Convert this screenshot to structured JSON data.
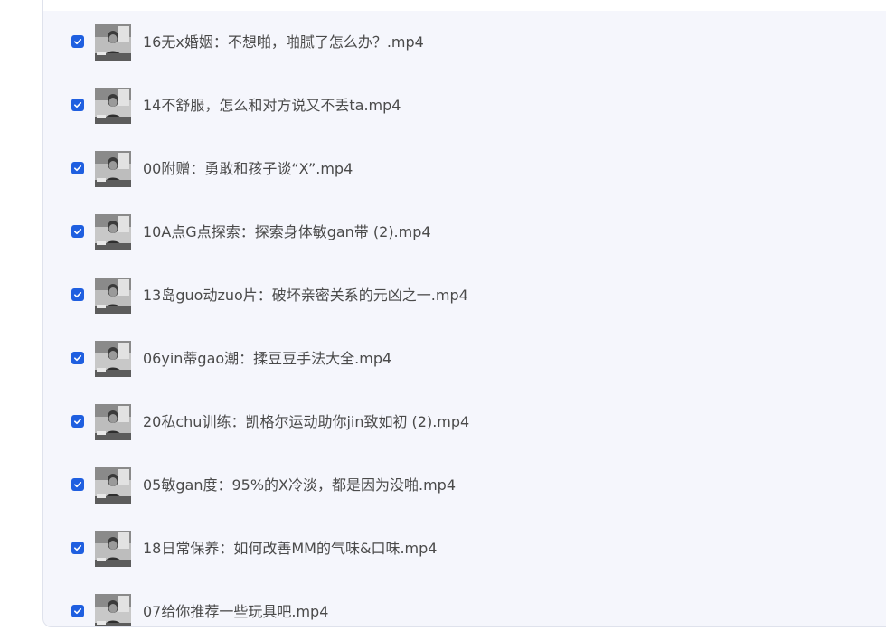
{
  "colors": {
    "panel_bg": "#f5f6fc",
    "checkbox_accent": "#1f5fe0",
    "text": "#4a4a4a"
  },
  "files": [
    {
      "name": "16无x婚姻：不想啪，啪腻了怎么办？.mp4",
      "checked": true,
      "thumbnail": "video-thumbnail"
    },
    {
      "name": "14不舒服，怎么和对方说又不丢ta.mp4",
      "checked": true,
      "thumbnail": "video-thumbnail"
    },
    {
      "name": "00附赠：勇敢和孩子谈“X”.mp4",
      "checked": true,
      "thumbnail": "video-thumbnail"
    },
    {
      "name": "10A点G点探索：探索身体敏gan带 (2).mp4",
      "checked": true,
      "thumbnail": "video-thumbnail"
    },
    {
      "name": "13岛guo动zuo片：破坏亲密关系的元凶之一.mp4",
      "checked": true,
      "thumbnail": "video-thumbnail"
    },
    {
      "name": "06yin蒂gao潮：揉豆豆手法大全.mp4",
      "checked": true,
      "thumbnail": "video-thumbnail"
    },
    {
      "name": "20私chu训练：凯格尔运动助你jin致如初 (2).mp4",
      "checked": true,
      "thumbnail": "video-thumbnail"
    },
    {
      "name": "05敏gan度：95%的X冷淡，都是因为没啪.mp4",
      "checked": true,
      "thumbnail": "video-thumbnail"
    },
    {
      "name": "18日常保养：如何改善MM的气味&口味.mp4",
      "checked": true,
      "thumbnail": "video-thumbnail"
    },
    {
      "name": "07给你推荐一些玩具吧.mp4",
      "checked": true,
      "thumbnail": "video-thumbnail"
    }
  ]
}
